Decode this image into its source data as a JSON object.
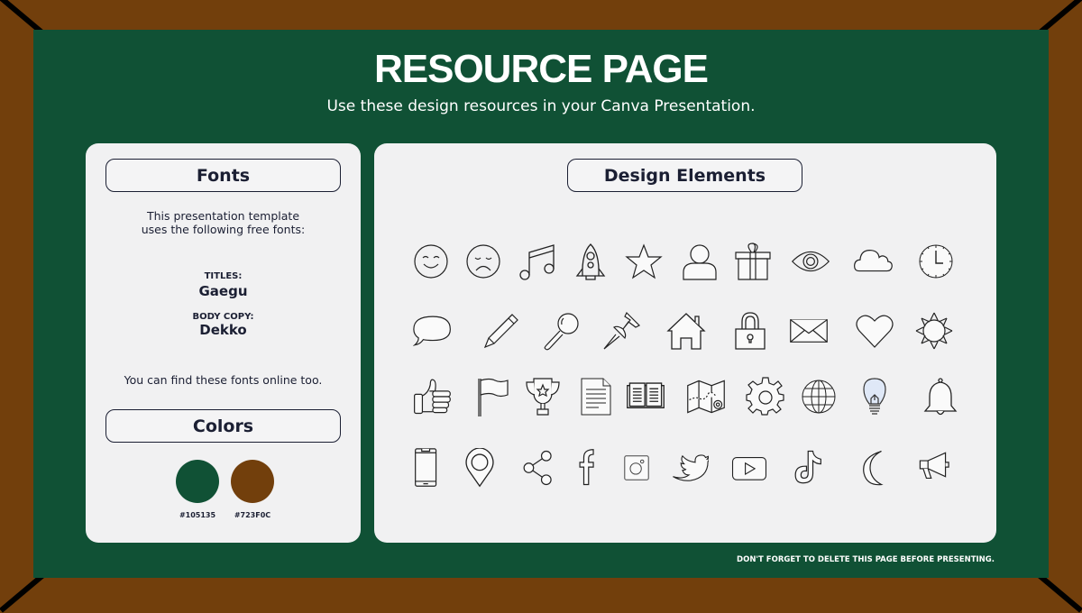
{
  "header": {
    "title": "RESOURCE PAGE",
    "subtitle": "Use these design resources in your Canva Presentation."
  },
  "fonts_panel": {
    "heading": "Fonts",
    "intro_line1": "This presentation template",
    "intro_line2": "uses the following free fonts:",
    "titles_label": "TITLES:",
    "titles_font": "Gaegu",
    "body_label": "BODY COPY:",
    "body_font": "Dekko",
    "note": "You can find these fonts online too."
  },
  "colors_panel": {
    "heading": "Colors",
    "swatches": [
      {
        "hex": "#105135",
        "label": "#105135"
      },
      {
        "hex": "#723F0C",
        "label": "#723F0C"
      }
    ]
  },
  "design_elements": {
    "heading": "Design Elements",
    "icons": [
      [
        "smiley-face-icon",
        "sad-face-icon",
        "music-note-icon",
        "rocket-icon",
        "star-icon",
        "user-icon",
        "gift-icon",
        "eye-icon",
        "cloud-icon",
        "clock-icon"
      ],
      [
        "speech-bubble-icon",
        "pencil-icon",
        "magnifier-icon",
        "pushpin-icon",
        "house-icon",
        "padlock-icon",
        "envelope-icon",
        "heart-icon",
        "sun-icon"
      ],
      [
        "thumbs-up-icon",
        "flag-icon",
        "trophy-icon",
        "document-icon",
        "open-book-icon",
        "map-icon",
        "gear-icon",
        "globe-icon",
        "lightbulb-icon",
        "bell-icon"
      ],
      [
        "smartphone-icon",
        "location-pin-icon",
        "share-icon",
        "facebook-icon",
        "instagram-icon",
        "twitter-icon",
        "youtube-icon",
        "tiktok-icon",
        "crescent-moon-icon",
        "megaphone-icon"
      ]
    ]
  },
  "footer": {
    "note": "DON'T FORGET TO DELETE THIS PAGE BEFORE PRESENTING."
  },
  "colors": {
    "frame": "#723F0C",
    "board": "#105135",
    "panel": "#F1F1F2",
    "ink": "#1B1F33"
  }
}
